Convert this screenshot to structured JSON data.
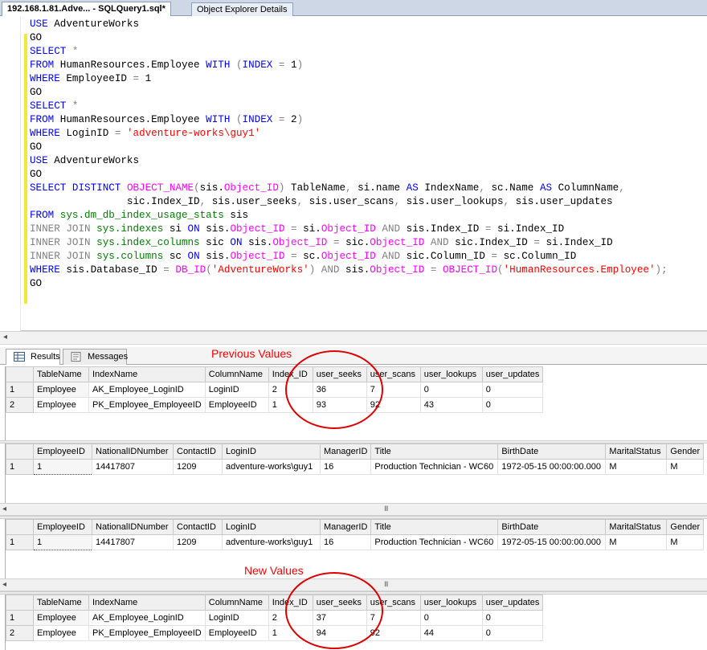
{
  "tabs": {
    "query_tab": "192.168.1.81.Adve... - SQLQuery1.sql*",
    "object_explorer_tab": "Object Explorer Details"
  },
  "code": [
    [
      {
        "t": "USE",
        "c": "kw"
      },
      {
        "t": " AdventureWorks"
      }
    ],
    [
      {
        "t": "GO"
      }
    ],
    [
      {
        "t": "SELECT",
        "c": "kw"
      },
      {
        "t": " *",
        "c": "gr"
      }
    ],
    [
      {
        "t": "FROM",
        "c": "kw"
      },
      {
        "t": " HumanResources.Employee "
      },
      {
        "t": "WITH",
        "c": "kw"
      },
      {
        "t": " (",
        "c": "gr"
      },
      {
        "t": "INDEX",
        "c": "kw"
      },
      {
        "t": " = ",
        "c": "gr"
      },
      {
        "t": "1"
      },
      {
        "t": ")",
        "c": "gr"
      }
    ],
    [
      {
        "t": "WHERE",
        "c": "kw"
      },
      {
        "t": " EmployeeID "
      },
      {
        "t": "=",
        "c": "gr"
      },
      {
        "t": " 1"
      }
    ],
    [
      {
        "t": "GO"
      }
    ],
    [
      {
        "t": "SELECT",
        "c": "kw"
      },
      {
        "t": " *",
        "c": "gr"
      }
    ],
    [
      {
        "t": "FROM",
        "c": "kw"
      },
      {
        "t": " HumanResources.Employee "
      },
      {
        "t": "WITH",
        "c": "kw"
      },
      {
        "t": " (",
        "c": "gr"
      },
      {
        "t": "INDEX",
        "c": "kw"
      },
      {
        "t": " = ",
        "c": "gr"
      },
      {
        "t": "2"
      },
      {
        "t": ")",
        "c": "gr"
      }
    ],
    [
      {
        "t": "WHERE",
        "c": "kw"
      },
      {
        "t": " LoginID "
      },
      {
        "t": "=",
        "c": "gr"
      },
      {
        "t": " "
      },
      {
        "t": "'adventure-works\\guy1'",
        "c": "str"
      }
    ],
    [
      {
        "t": "GO"
      }
    ],
    [
      {
        "t": "USE",
        "c": "kw"
      },
      {
        "t": " AdventureWorks"
      }
    ],
    [
      {
        "t": "GO"
      }
    ],
    [
      {
        "t": "SELECT DISTINCT",
        "c": "kw"
      },
      {
        "t": " "
      },
      {
        "t": "OBJECT_NAME",
        "c": "fn"
      },
      {
        "t": "(",
        "c": "gr"
      },
      {
        "t": "sis."
      },
      {
        "t": "Object_ID",
        "c": "fn"
      },
      {
        "t": ")",
        "c": "gr"
      },
      {
        "t": " TableName"
      },
      {
        "t": ",",
        "c": "gr"
      },
      {
        "t": " si.name "
      },
      {
        "t": "AS",
        "c": "kw"
      },
      {
        "t": " IndexName"
      },
      {
        "t": ",",
        "c": "gr"
      },
      {
        "t": " sc.Name "
      },
      {
        "t": "AS",
        "c": "kw"
      },
      {
        "t": " ColumnName"
      },
      {
        "t": ",",
        "c": "gr"
      }
    ],
    [
      {
        "t": "                sic.Index_ID"
      },
      {
        "t": ",",
        "c": "gr"
      },
      {
        "t": " sis.user_seeks"
      },
      {
        "t": ",",
        "c": "gr"
      },
      {
        "t": " sis.user_scans"
      },
      {
        "t": ",",
        "c": "gr"
      },
      {
        "t": " sis.user_lookups"
      },
      {
        "t": ",",
        "c": "gr"
      },
      {
        "t": " sis.user_updates"
      }
    ],
    [
      {
        "t": "FROM",
        "c": "kw"
      },
      {
        "t": " "
      },
      {
        "t": "sys.dm_db_index_usage_stats",
        "c": "sys"
      },
      {
        "t": " sis"
      }
    ],
    [
      {
        "t": "INNER JOIN",
        "c": "gr"
      },
      {
        "t": " "
      },
      {
        "t": "sys.indexes",
        "c": "sys"
      },
      {
        "t": " si "
      },
      {
        "t": "ON",
        "c": "kw"
      },
      {
        "t": " sis."
      },
      {
        "t": "Object_ID",
        "c": "fn"
      },
      {
        "t": " = ",
        "c": "gr"
      },
      {
        "t": "si."
      },
      {
        "t": "Object_ID",
        "c": "fn"
      },
      {
        "t": " AND ",
        "c": "gr"
      },
      {
        "t": "sis.Index_ID "
      },
      {
        "t": "=",
        "c": "gr"
      },
      {
        "t": " si.Index_ID"
      }
    ],
    [
      {
        "t": "INNER JOIN",
        "c": "gr"
      },
      {
        "t": " "
      },
      {
        "t": "sys.index_columns",
        "c": "sys"
      },
      {
        "t": " sic "
      },
      {
        "t": "ON",
        "c": "kw"
      },
      {
        "t": " sis."
      },
      {
        "t": "Object_ID",
        "c": "fn"
      },
      {
        "t": " = ",
        "c": "gr"
      },
      {
        "t": "sic."
      },
      {
        "t": "Object_ID",
        "c": "fn"
      },
      {
        "t": " AND ",
        "c": "gr"
      },
      {
        "t": "sic.Index_ID "
      },
      {
        "t": "=",
        "c": "gr"
      },
      {
        "t": " si.Index_ID"
      }
    ],
    [
      {
        "t": "INNER JOIN",
        "c": "gr"
      },
      {
        "t": " "
      },
      {
        "t": "sys.columns",
        "c": "sys"
      },
      {
        "t": " sc "
      },
      {
        "t": "ON",
        "c": "kw"
      },
      {
        "t": " sis."
      },
      {
        "t": "Object_ID",
        "c": "fn"
      },
      {
        "t": " = ",
        "c": "gr"
      },
      {
        "t": "sc."
      },
      {
        "t": "Object_ID",
        "c": "fn"
      },
      {
        "t": " AND ",
        "c": "gr"
      },
      {
        "t": "sic.Column_ID "
      },
      {
        "t": "=",
        "c": "gr"
      },
      {
        "t": " sc.Column_ID"
      }
    ],
    [
      {
        "t": "WHERE",
        "c": "kw"
      },
      {
        "t": " sis.Database_ID "
      },
      {
        "t": "=",
        "c": "gr"
      },
      {
        "t": " "
      },
      {
        "t": "DB_ID",
        "c": "fn"
      },
      {
        "t": "(",
        "c": "gr"
      },
      {
        "t": "'AdventureWorks'",
        "c": "str"
      },
      {
        "t": ")",
        "c": "gr"
      },
      {
        "t": " AND ",
        "c": "gr"
      },
      {
        "t": "sis."
      },
      {
        "t": "Object_ID",
        "c": "fn"
      },
      {
        "t": " = ",
        "c": "gr"
      },
      {
        "t": "OBJECT_ID",
        "c": "fn"
      },
      {
        "t": "(",
        "c": "gr"
      },
      {
        "t": "'HumanResources.Employee'",
        "c": "str"
      },
      {
        "t": ");",
        "c": "gr"
      }
    ],
    [
      {
        "t": "GO"
      }
    ]
  ],
  "results_tabs": {
    "results": "Results",
    "messages": "Messages"
  },
  "annotations": {
    "previous": "Previous Values",
    "new": "New Values",
    "color": "#ff0000"
  },
  "index_columns": [
    "TableName",
    "IndexName",
    "ColumnName",
    "Index_ID",
    "user_seeks",
    "user_scans",
    "user_lookups",
    "user_updates"
  ],
  "index_prev_rows": [
    [
      "1",
      "Employee",
      "AK_Employee_LoginID",
      "LoginID",
      "2",
      "36",
      "7",
      "0",
      "0"
    ],
    [
      "2",
      "Employee",
      "PK_Employee_EmployeeID",
      "EmployeeID",
      "1",
      "93",
      "92",
      "43",
      "0"
    ]
  ],
  "index_new_rows": [
    [
      "1",
      "Employee",
      "AK_Employee_LoginID",
      "LoginID",
      "2",
      "37",
      "7",
      "0",
      "0"
    ],
    [
      "2",
      "Employee",
      "PK_Employee_EmployeeID",
      "EmployeeID",
      "1",
      "94",
      "92",
      "44",
      "0"
    ]
  ],
  "employee_columns": [
    "EmployeeID",
    "NationalIDNumber",
    "ContactID",
    "LoginID",
    "ManagerID",
    "Title",
    "BirthDate",
    "MaritalStatus",
    "Gender"
  ],
  "employee_row_1": [
    "1",
    "1",
    "14417807",
    "1209",
    "adventure-works\\guy1",
    "16",
    "Production Technician - WC60",
    "1972-05-15 00:00:00.000",
    "M",
    "M"
  ],
  "employee_row_2": [
    "1",
    "1",
    "14417807",
    "1209",
    "adventure-works\\guy1",
    "16",
    "Production Technician - WC60",
    "1972-05-15 00:00:00.000",
    "M",
    "M"
  ],
  "scroll": {
    "left_arrow": "◂",
    "grip": "III"
  }
}
